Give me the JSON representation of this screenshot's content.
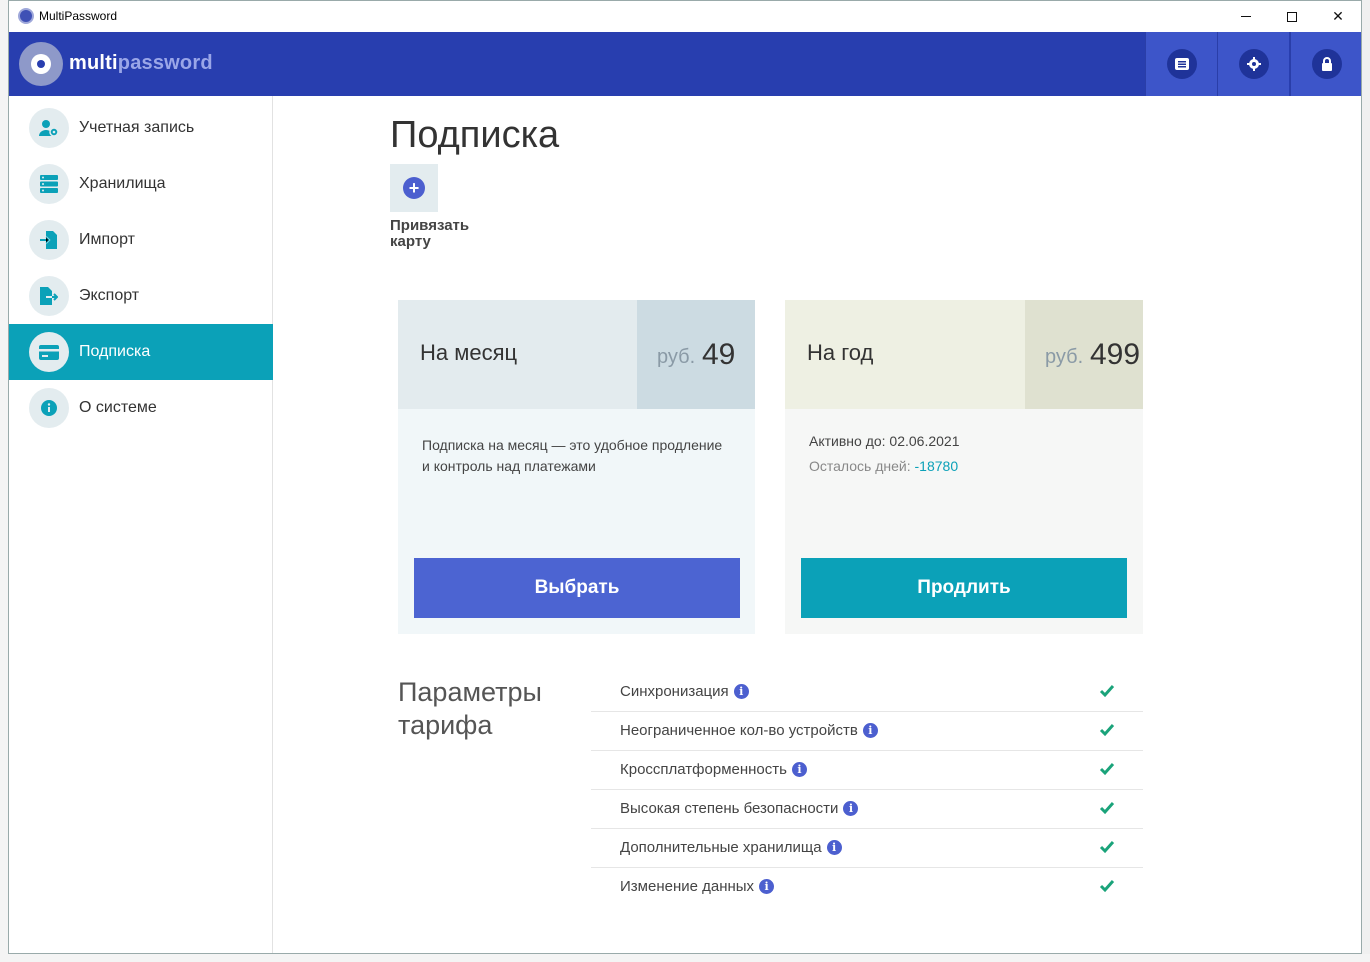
{
  "window": {
    "title": "MultiPassword"
  },
  "header": {
    "logo_bold": "multi",
    "logo_light": "password"
  },
  "sidebar": {
    "items": [
      {
        "label": "Учетная запись",
        "icon": "user-gear-icon"
      },
      {
        "label": "Хранилища",
        "icon": "storage-icon"
      },
      {
        "label": "Импорт",
        "icon": "import-icon"
      },
      {
        "label": "Экспорт",
        "icon": "export-icon"
      },
      {
        "label": "Подписка",
        "icon": "credit-card-icon",
        "active": true
      },
      {
        "label": "О системе",
        "icon": "info-icon"
      }
    ]
  },
  "main": {
    "title": "Подписка",
    "add_card_label_1": "Привязать",
    "add_card_label_2": "карту",
    "plans": {
      "month": {
        "name": "На месяц",
        "currency": "руб.",
        "amount": "49",
        "description": "Подписка на месяц — это удобное продление и контроль над платежами",
        "button": "Выбрать"
      },
      "year": {
        "name": "На год",
        "currency": "руб.",
        "amount": "499",
        "active_until": "Активно до: 02.06.2021",
        "days_left_label": "Осталось дней: ",
        "days_left_value": "-18780",
        "button": "Продлить"
      }
    },
    "params_title_1": "Параметры",
    "params_title_2": "тарифа",
    "params": [
      {
        "label": "Синхронизация"
      },
      {
        "label": "Неограниченное кол-во устройств"
      },
      {
        "label": "Кроссплатформенность"
      },
      {
        "label": "Высокая степень безопасности"
      },
      {
        "label": "Дополнительные хранилища"
      },
      {
        "label": "Изменение данных"
      }
    ]
  },
  "colors": {
    "header": "#283eaf",
    "accent": "#0ba1b8",
    "primary_button": "#4c64d2",
    "check": "#1aa37a"
  }
}
